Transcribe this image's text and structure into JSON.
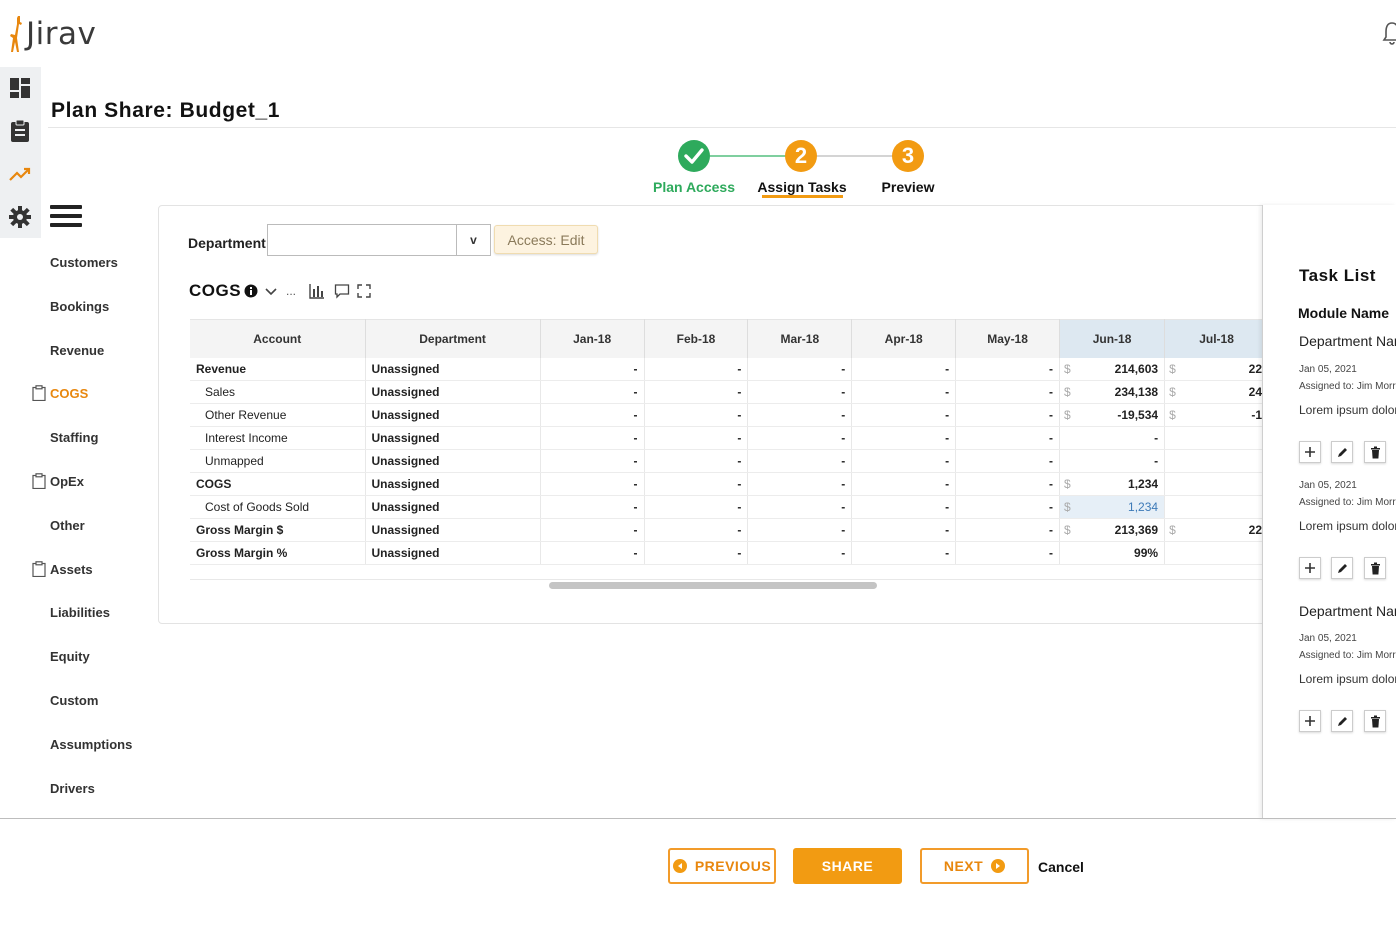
{
  "app": {
    "logo_text": "Jirav"
  },
  "page": {
    "title": "Plan Share: Budget_1"
  },
  "stepper": {
    "steps": [
      {
        "label": "Plan Access",
        "number": "",
        "state": "complete",
        "color": "#2eaa5c"
      },
      {
        "label": "Assign Tasks",
        "number": "2",
        "state": "active",
        "color": "#f29b12"
      },
      {
        "label": "Preview",
        "number": "3",
        "state": "pending",
        "color": "#f29b12"
      }
    ]
  },
  "sidebar": {
    "items": [
      {
        "label": "Customers",
        "active": false,
        "clip": false
      },
      {
        "label": "Bookings",
        "active": false,
        "clip": false
      },
      {
        "label": "Revenue",
        "active": false,
        "clip": false
      },
      {
        "label": "COGS",
        "active": true,
        "clip": true
      },
      {
        "label": "Staffing",
        "active": false,
        "clip": false
      },
      {
        "label": "OpEx",
        "active": false,
        "clip": true
      },
      {
        "label": "Other",
        "active": false,
        "clip": false
      },
      {
        "label": "Assets",
        "active": false,
        "clip": true
      },
      {
        "label": "Liabilities",
        "active": false,
        "clip": false
      },
      {
        "label": "Equity",
        "active": false,
        "clip": false
      },
      {
        "label": "Custom",
        "active": false,
        "clip": false
      },
      {
        "label": "Assumptions",
        "active": false,
        "clip": false
      },
      {
        "label": "Drivers",
        "active": false,
        "clip": false
      }
    ]
  },
  "filters": {
    "department_label": "Department",
    "department_value": "",
    "caret": "v",
    "access_badge": "Access: Edit"
  },
  "module": {
    "title": "COGS",
    "more": "..."
  },
  "table": {
    "columns": [
      "Account",
      "Department",
      "Jan-18",
      "Feb-18",
      "Mar-18",
      "Apr-18",
      "May-18",
      "Jun-18",
      "Jul-18"
    ],
    "currency_symbol": "$",
    "rows": [
      {
        "account": "Revenue",
        "child": false,
        "department": "Unassigned",
        "months": [
          "-",
          "-",
          "-",
          "-",
          "-"
        ],
        "jun": "214,603",
        "jun_cur": true,
        "jul": "22",
        "jul_cur": true
      },
      {
        "account": "Sales",
        "child": true,
        "department": "Unassigned",
        "months": [
          "-",
          "-",
          "-",
          "-",
          "-"
        ],
        "jun": "234,138",
        "jun_cur": true,
        "jul": "24",
        "jul_cur": true
      },
      {
        "account": "Other Revenue",
        "child": true,
        "department": "Unassigned",
        "months": [
          "-",
          "-",
          "-",
          "-",
          "-"
        ],
        "jun": "-19,534",
        "jun_cur": true,
        "jul": "-1",
        "jul_cur": true
      },
      {
        "account": "Interest Income",
        "child": true,
        "department": "Unassigned",
        "months": [
          "-",
          "-",
          "-",
          "-",
          "-"
        ],
        "jun": "-",
        "jun_cur": false,
        "jul": "",
        "jul_cur": false
      },
      {
        "account": "Unmapped",
        "child": true,
        "department": "Unassigned",
        "months": [
          "-",
          "-",
          "-",
          "-",
          "-"
        ],
        "jun": "-",
        "jun_cur": false,
        "jul": "",
        "jul_cur": false
      },
      {
        "account": "COGS",
        "child": false,
        "department": "Unassigned",
        "months": [
          "-",
          "-",
          "-",
          "-",
          "-"
        ],
        "jun": "1,234",
        "jun_cur": true,
        "jul": "",
        "jul_cur": false
      },
      {
        "account": "Cost of Goods Sold",
        "child": true,
        "department": "Unassigned",
        "months": [
          "-",
          "-",
          "-",
          "-",
          "-"
        ],
        "jun": "1,234",
        "jun_cur": true,
        "jul": "",
        "jul_cur": false,
        "selected": true
      },
      {
        "account": "Gross Margin $",
        "child": false,
        "department": "Unassigned",
        "months": [
          "-",
          "-",
          "-",
          "-",
          "-"
        ],
        "jun": "213,369",
        "jun_cur": true,
        "jul": "22",
        "jul_cur": true
      },
      {
        "account": "Gross Margin %",
        "child": false,
        "department": "Unassigned",
        "months": [
          "-",
          "-",
          "-",
          "-",
          "-"
        ],
        "jun": "99%",
        "jun_cur": false,
        "jul": "",
        "jul_cur": false
      }
    ]
  },
  "task_panel": {
    "title": "Task List",
    "module_name": "Module Name",
    "groups": [
      {
        "department": "Department Nar",
        "tasks": [
          {
            "date": "Jan 05, 2021",
            "assigned": "Assigned to: Jim Morr",
            "note": "Lorem ipsum dolor"
          },
          {
            "date": "Jan 05, 2021",
            "assigned": "Assigned to: Jim Morr",
            "note": "Lorem ipsum dolor"
          }
        ]
      },
      {
        "department": "Department Nar",
        "tasks": [
          {
            "date": "Jan 05, 2021",
            "assigned": "Assigned to: Jim Morr",
            "note": "Lorem ipsum dolor"
          }
        ]
      }
    ]
  },
  "footer": {
    "previous_label": "PREVIOUS",
    "share_label": "SHARE",
    "next_label": "NEXT",
    "cancel_label": "Cancel"
  },
  "colors": {
    "accent": "#f29b12",
    "success": "#2eaa5c"
  }
}
